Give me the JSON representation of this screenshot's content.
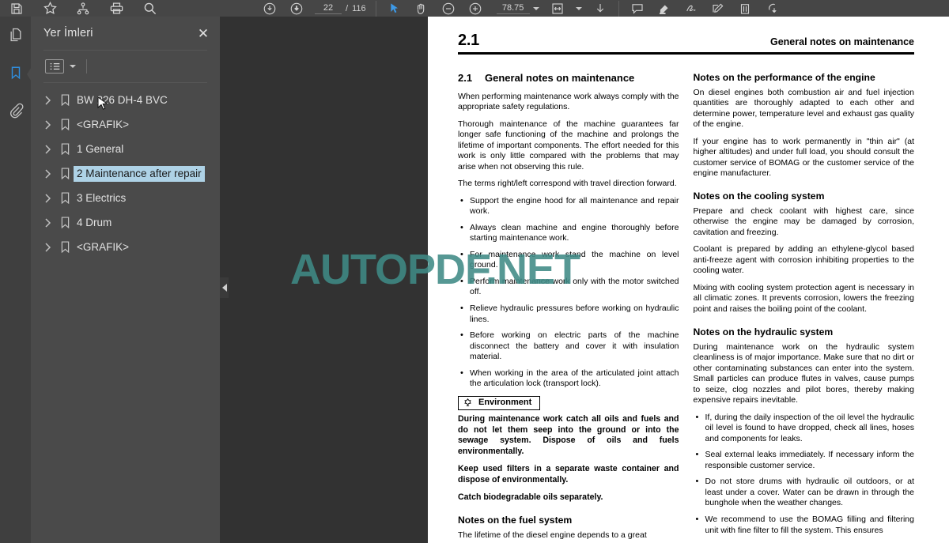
{
  "toolbar": {
    "left_icons": [
      "save-icon",
      "bookmark-star-icon",
      "tree-icon",
      "print-icon",
      "search-icon"
    ],
    "page_current": "22",
    "page_separator": "/",
    "page_total": "116",
    "zoom_value": "78.75",
    "right_icons": [
      "zoom-out-icon",
      "zoom-in-icon",
      "select-cursor-icon",
      "hand-icon",
      "minus-circle-icon",
      "plus-circle-icon",
      "fit-width-icon",
      "download-icon",
      "comment-icon",
      "highlight-icon",
      "freehand-icon",
      "pencil-icon",
      "trash-icon",
      "stamp-icon"
    ],
    "accent_color": "#3d9ae8"
  },
  "rail": {
    "items": [
      {
        "name": "pages-icon",
        "label": "Sayfalar",
        "selected": false
      },
      {
        "name": "bookmark-icon",
        "label": "Yer İmleri",
        "selected": true
      },
      {
        "name": "attachment-icon",
        "label": "Ekler",
        "selected": false
      }
    ]
  },
  "bookmarks_panel": {
    "title": "Yer İmleri",
    "close_label": "✕",
    "options_icon": "list-options-icon",
    "items": [
      {
        "label": "BW 226 DH-4 BVC",
        "selected": false
      },
      {
        "label": "<GRAFIK>",
        "selected": false
      },
      {
        "label": "1 General",
        "selected": false
      },
      {
        "label": "2 Maintenance after repair",
        "selected": true
      },
      {
        "label": "3 Electrics",
        "selected": false
      },
      {
        "label": "4 Drum",
        "selected": false
      },
      {
        "label": "<GRAFIK>",
        "selected": false
      }
    ],
    "selection_color": "#aed2e6"
  },
  "watermark": {
    "text": "AUTOPDF.NET",
    "color": "#3f8a86"
  },
  "page": {
    "header": {
      "section_number": "2.1",
      "section_title": "General notes on maintenance"
    },
    "left_column": {
      "heading_number": "2.1",
      "heading_text": "General notes on maintenance",
      "paragraphs": [
        "When performing maintenance work always comply with the appropriate safety regulations.",
        "Thorough maintenance of the machine guarantees far longer safe functioning of the machine and prolongs the lifetime of important components. The effort needed for this work is only little compared with the problems that may arise when not observing this rule.",
        "The terms right/left correspond with travel direction forward."
      ],
      "bullets": [
        "Support the engine hood for all maintenance and repair work.",
        "Always clean machine and engine thoroughly before starting maintenance work.",
        "For maintenance work stand the machine on level ground.",
        "Perform maintenance work only with the motor switched off.",
        "Relieve hydraulic pressures before working on hydraulic lines.",
        "Before working on electric parts of the machine disconnect the battery and cover it with insulation material.",
        "When working in the area of the articulated joint attach the articulation lock (transport lock)."
      ],
      "environment_box": {
        "icon": "environment-leaf-icon",
        "label": "Environment"
      },
      "environment_paragraphs": [
        "During maintenance work catch all oils and fuels and do not let them seep into the ground or into the sewage system. Dispose of oils and fuels environmentally.",
        "Keep used filters in a separate waste container and dispose of environmentally.",
        "Catch biodegradable oils separately."
      ],
      "fuel_heading": "Notes on the fuel system",
      "fuel_paragraph": "The lifetime of the diesel engine depends to a great"
    },
    "right_column": {
      "engine": {
        "heading": "Notes on the performance of the engine",
        "paragraphs": [
          "On diesel engines both combustion air and fuel injection quantities are thoroughly adapted to each other and determine power, temperature level and exhaust gas quality of the engine.",
          "If your engine has to work permanently in \"thin air\" (at higher altitudes) and under full load, you should consult the customer service of BOMAG or the customer service of the engine manufacturer."
        ]
      },
      "cooling": {
        "heading": "Notes on the cooling system",
        "paragraphs": [
          "Prepare and check coolant with highest care, since otherwise the engine may be damaged by corrosion, cavitation and freezing.",
          "Coolant is prepared by adding an ethylene-glycol based anti-freeze agent with corrosion inhibiting properties  to the cooling water.",
          "Mixing with cooling system protection agent is necessary in all climatic zones. It prevents corrosion, lowers the freezing point and raises the boiling point of the coolant."
        ]
      },
      "hydraulic": {
        "heading": "Notes on the hydraulic system",
        "paragraphs": [
          "During maintenance work on the hydraulic system cleanliness is of major importance. Make sure that no dirt or other contaminating substances can enter into the system. Small particles can produce flutes in valves, cause pumps to seize, clog nozzles and pilot bores, thereby making expensive repairs inevitable."
        ],
        "bullets": [
          "If, during the daily inspection of the oil level the hydraulic oil level is found to have dropped, check all lines, hoses and components for leaks.",
          "Seal external leaks immediately. If necessary inform the responsible customer service.",
          "Do not store drums with hydraulic oil outdoors, or at least under a cover. Water can be drawn in through the bunghole when the weather changes.",
          "We recommend to use the BOMAG filling and filtering unit with fine filter to fill the system. This ensures"
        ]
      }
    }
  }
}
